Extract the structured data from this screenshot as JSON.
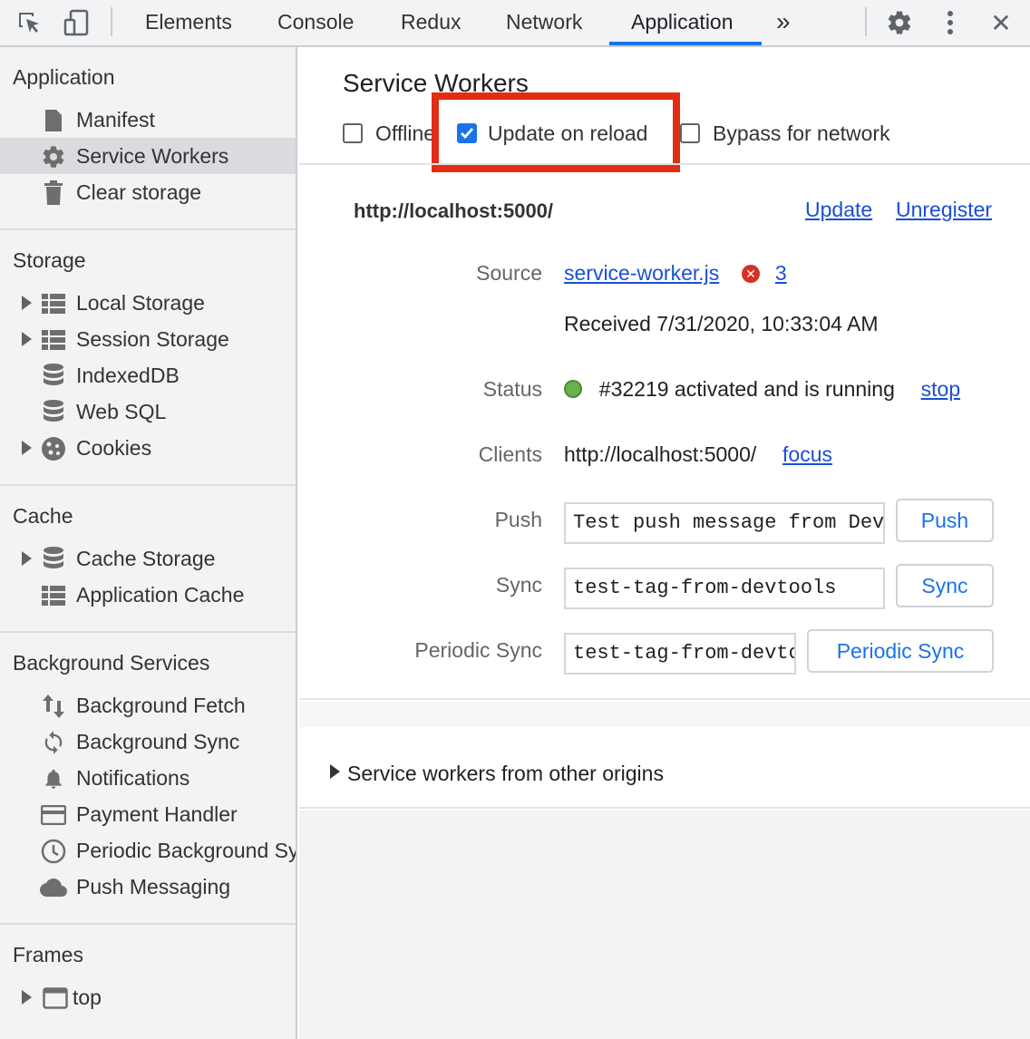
{
  "toolbar": {
    "tabs": [
      {
        "label": "Elements"
      },
      {
        "label": "Console"
      },
      {
        "label": "Redux"
      },
      {
        "label": "Network"
      },
      {
        "label": "Application"
      }
    ],
    "more_label": "»",
    "close_label": "✕"
  },
  "sidebar": {
    "sections": [
      {
        "title": "Application",
        "items": [
          {
            "label": "Manifest",
            "icon": "document-icon"
          },
          {
            "label": "Service Workers",
            "icon": "gear-icon"
          },
          {
            "label": "Clear storage",
            "icon": "trash-icon"
          }
        ]
      },
      {
        "title": "Storage",
        "items": [
          {
            "label": "Local Storage",
            "icon": "grid-icon"
          },
          {
            "label": "Session Storage",
            "icon": "grid-icon"
          },
          {
            "label": "IndexedDB",
            "icon": "database-icon"
          },
          {
            "label": "Web SQL",
            "icon": "database-icon"
          },
          {
            "label": "Cookies",
            "icon": "cookie-icon"
          }
        ]
      },
      {
        "title": "Cache",
        "items": [
          {
            "label": "Cache Storage",
            "icon": "database-icon"
          },
          {
            "label": "Application Cache",
            "icon": "grid-icon"
          }
        ]
      },
      {
        "title": "Background Services",
        "items": [
          {
            "label": "Background Fetch",
            "icon": "up-down-arrows-icon"
          },
          {
            "label": "Background Sync",
            "icon": "sync-icon"
          },
          {
            "label": "Notifications",
            "icon": "bell-icon"
          },
          {
            "label": "Payment Handler",
            "icon": "card-icon"
          },
          {
            "label": "Periodic Background Sync",
            "icon": "clock-icon"
          },
          {
            "label": "Push Messaging",
            "icon": "cloud-icon"
          }
        ]
      },
      {
        "title": "Frames",
        "items": [
          {
            "label": "top",
            "icon": "frame-icon"
          }
        ]
      }
    ]
  },
  "main": {
    "title": "Service Workers",
    "options": {
      "offline": {
        "label": "Offline",
        "checked": false
      },
      "update_on_reload": {
        "label": "Update on reload",
        "checked": true
      },
      "bypass_for_network": {
        "label": "Bypass for network",
        "checked": false
      }
    },
    "worker": {
      "origin": "http://localhost:5000/",
      "update_label": "Update",
      "unregister_label": "Unregister",
      "source_label": "Source",
      "source_file": "service-worker.js",
      "error_glyph": "✕",
      "error_count": "3",
      "received": "Received 7/31/2020, 10:33:04 AM",
      "status_label": "Status",
      "status_text": "#32219 activated and is running",
      "stop_label": "stop",
      "clients_label": "Clients",
      "client_url": "http://localhost:5000/",
      "focus_label": "focus",
      "push_label": "Push",
      "push_value": "Test push message from DevTools.",
      "push_button": "Push",
      "sync_label": "Sync",
      "sync_value": "test-tag-from-devtools",
      "sync_button": "Sync",
      "periodic_label": "Periodic Sync",
      "periodic_value": "test-tag-from-devtools",
      "periodic_button": "Periodic Sync"
    },
    "other_origins": "Service workers from other origins"
  },
  "colors": {
    "accent": "#1a73e8",
    "highlight": "#e02d14",
    "status_running": "#6ab04c",
    "error": "#d93025"
  }
}
